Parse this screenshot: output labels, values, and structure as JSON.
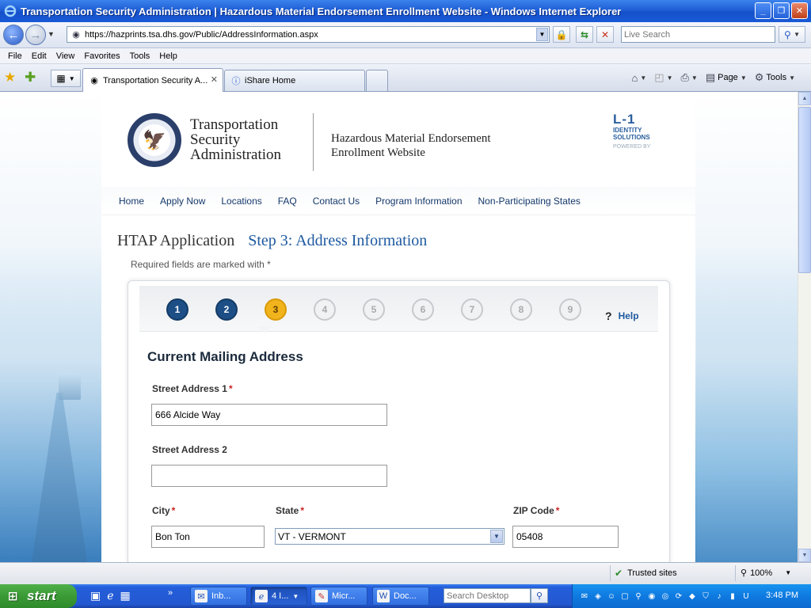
{
  "window": {
    "title": "Transportation Security Administration | Hazardous Material Endorsement Enrollment Website - Windows Internet Explorer"
  },
  "address_bar": {
    "url": "https://hazprints.tsa.dhs.gov/Public/AddressInformation.aspx",
    "search_placeholder": "Live Search"
  },
  "menu": [
    "File",
    "Edit",
    "View",
    "Favorites",
    "Tools",
    "Help"
  ],
  "tabs": [
    {
      "label": "Transportation Security A..."
    },
    {
      "label": "iShare Home"
    }
  ],
  "command_bar": {
    "page_label": "Page",
    "tools_label": "Tools"
  },
  "site": {
    "agency_lines": [
      "Transportation",
      "Security",
      "Administration"
    ],
    "site_title_lines": [
      "Hazardous Material Endorsement",
      "Enrollment Website"
    ],
    "partner_logo": {
      "mark": "L-1",
      "line1": "IDENTITY",
      "line2": "SOLUTIONS",
      "powered": "POWERED BY"
    },
    "nav": [
      "Home",
      "Apply Now",
      "Locations",
      "FAQ",
      "Contact Us",
      "Program Information",
      "Non-Participating States"
    ]
  },
  "application": {
    "heading": "HTAP Application",
    "step_heading": "Step 3: Address Information",
    "required_note": "Required fields are marked with *",
    "steps": [
      "1",
      "2",
      "3",
      "4",
      "5",
      "6",
      "7",
      "8",
      "9"
    ],
    "current_step": 3,
    "help_symbol": "?",
    "help_label": "Help"
  },
  "form": {
    "section_title": "Current Mailing Address",
    "required_marker": "*",
    "street1": {
      "label": "Street Address 1",
      "value": "666 Alcide Way"
    },
    "street2": {
      "label": "Street Address 2",
      "value": ""
    },
    "city": {
      "label": "City",
      "value": "Bon Ton"
    },
    "state": {
      "label": "State",
      "value": "VT - VERMONT"
    },
    "zip": {
      "label": "ZIP Code",
      "value": "05408"
    }
  },
  "status_bar": {
    "zone": "Trusted sites",
    "zoom": "100%"
  },
  "taskbar": {
    "start_label": "start",
    "buttons": [
      {
        "label": "Inb..."
      },
      {
        "label": "4 I..."
      },
      {
        "label": "Micr..."
      },
      {
        "label": "Doc..."
      }
    ],
    "search_placeholder": "Search Desktop",
    "clock": "3:48 PM"
  },
  "colors": {
    "title_bar": "#1f5fd6",
    "link_blue": "#1e5aa0",
    "step_done": "#1d4f86",
    "step_current": "#f2b41c",
    "required_red": "#cc2222",
    "start_green": "#3a9a35"
  }
}
